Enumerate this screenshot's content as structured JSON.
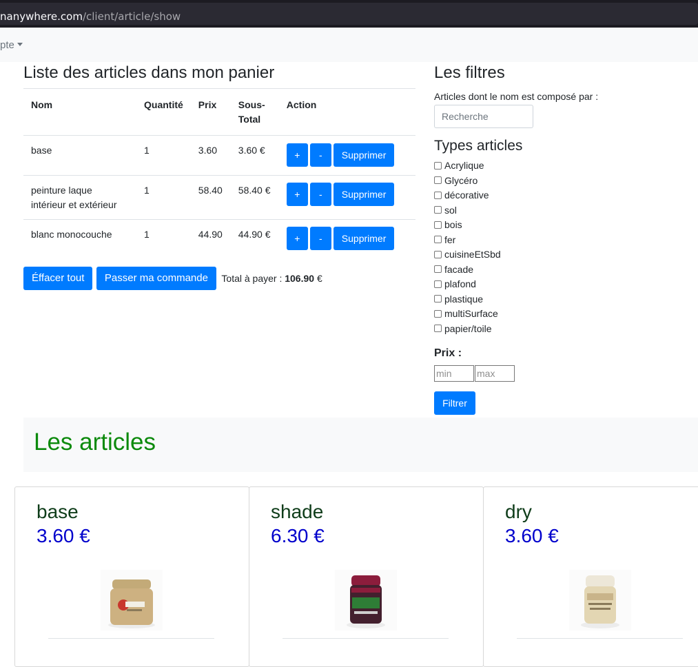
{
  "browser": {
    "url_host": "nanywhere.com",
    "url_path": "/client/article/show"
  },
  "nav": {
    "account_label": "pte"
  },
  "cart": {
    "title": "Liste des articles dans mon panier",
    "headers": {
      "nom": "Nom",
      "quantite": "Quantité",
      "prix": "Prix",
      "sous_total_1": "Sous-",
      "sous_total_2": "Total",
      "action": "Action"
    },
    "rows": [
      {
        "nom": "base",
        "quantite": "1",
        "prix": "3.60",
        "sous_total": "3.60 €"
      },
      {
        "nom": "peinture laque intérieur et extérieur",
        "quantite": "1",
        "prix": "58.40",
        "sous_total": "58.40 €"
      },
      {
        "nom": "blanc monocouche",
        "quantite": "1",
        "prix": "44.90",
        "sous_total": "44.90 €"
      }
    ],
    "plus_label": "+",
    "minus_label": "-",
    "delete_label": "Supprimer",
    "clear_label": "Éffacer tout",
    "order_label": "Passer ma commande",
    "total_label": "Total à payer :",
    "total_value": "106.90",
    "total_currency": "€"
  },
  "filters": {
    "title": "Les filtres",
    "name_label": "Articles dont le nom est composé par :",
    "search_placeholder": "Recherche",
    "types_title": "Types articles",
    "types": [
      "Acrylique",
      "Glycéro",
      "décorative",
      "sol",
      "bois",
      "fer",
      "cuisineEtSbd",
      "facade",
      "plafond",
      "plastique",
      "multiSurface",
      "papier/toile"
    ],
    "price_title": "Prix :",
    "min_placeholder": "min",
    "max_placeholder": "max",
    "filter_label": "Filtrer"
  },
  "articles": {
    "title": "Les articles",
    "items": [
      {
        "name": "base",
        "price": "3.60 €"
      },
      {
        "name": "shade",
        "price": "6.30 €"
      },
      {
        "name": "dry",
        "price": "3.60 €"
      }
    ]
  },
  "colors": {
    "primary": "#007bff",
    "articles_title": "#0c8a0c",
    "price": "#0000cc"
  }
}
